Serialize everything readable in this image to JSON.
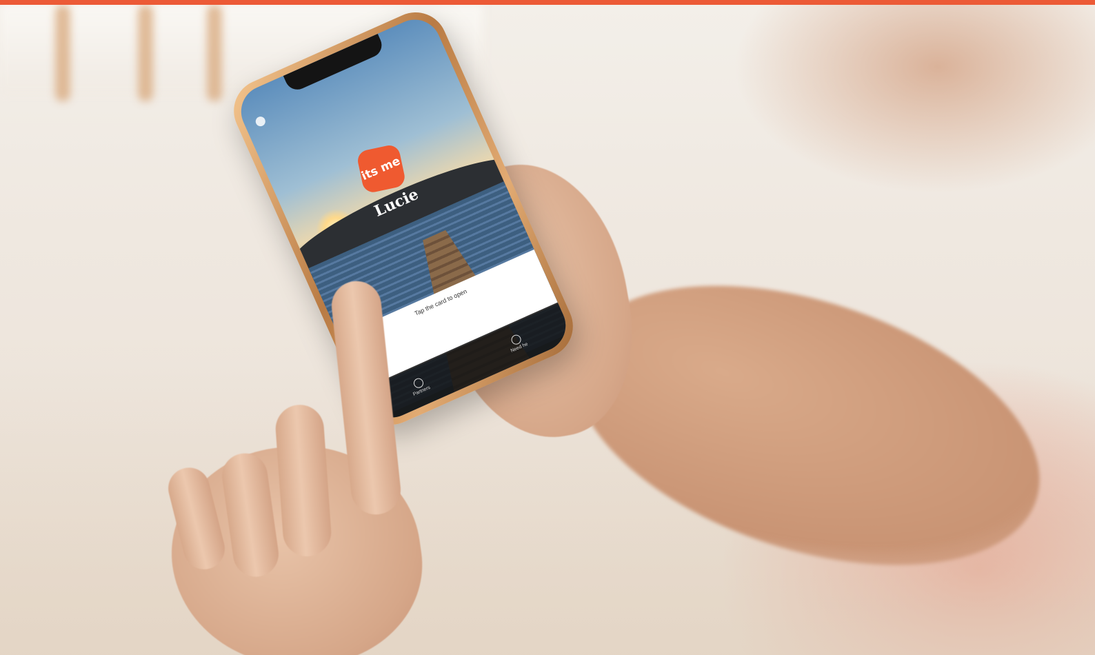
{
  "accent_color": "#ec5a36",
  "app": {
    "logo_text": "its me",
    "user_name": "Lucie",
    "card_hint": "Tap the card to open",
    "tabs": [
      {
        "label": "Partners",
        "icon": "search-icon"
      },
      {
        "label": "Need he",
        "icon": "help-icon"
      }
    ]
  }
}
